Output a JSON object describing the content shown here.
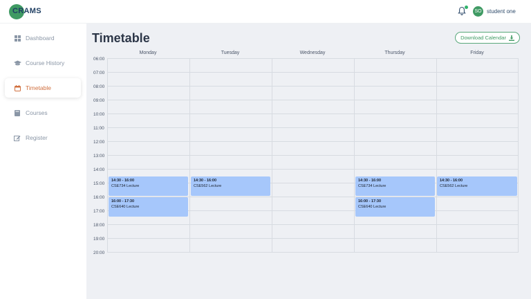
{
  "app": {
    "logo_text": "CRAMS"
  },
  "user": {
    "initials": "SO",
    "name": "student one"
  },
  "sidebar": {
    "items": [
      {
        "label": "Dashboard",
        "icon": "dashboard-icon"
      },
      {
        "label": "Course History",
        "icon": "graduation-cap-icon"
      },
      {
        "label": "Timetable",
        "icon": "calendar-icon",
        "active": true
      },
      {
        "label": "Courses",
        "icon": "book-icon"
      },
      {
        "label": "Register",
        "icon": "edit-icon"
      }
    ]
  },
  "page": {
    "title": "Timetable",
    "download_label": "Download Calendar"
  },
  "calendar": {
    "days": [
      "Monday",
      "Tuesday",
      "Wednesday",
      "Thursday",
      "Friday"
    ],
    "hours": [
      "06:00",
      "07:00",
      "08:00",
      "09:00",
      "10:00",
      "11:00",
      "12:00",
      "13:00",
      "14:00",
      "15:00",
      "16:00",
      "17:00",
      "18:00",
      "19:00",
      "20:00"
    ],
    "events": [
      {
        "day": "Monday",
        "time": "14:30 - 16:00",
        "title": "CSE734 Lecture",
        "start_hour": 14.5,
        "end_hour": 16.0
      },
      {
        "day": "Monday",
        "time": "16:00 - 17:30",
        "title": "CSE640 Lecture",
        "start_hour": 16.0,
        "end_hour": 17.5
      },
      {
        "day": "Tuesday",
        "time": "14:30 - 16:00",
        "title": "CSE562 Lecture",
        "start_hour": 14.5,
        "end_hour": 16.0
      },
      {
        "day": "Thursday",
        "time": "14:30 - 16:00",
        "title": "CSE734 Lecture",
        "start_hour": 14.5,
        "end_hour": 16.0
      },
      {
        "day": "Thursday",
        "time": "16:00 - 17:30",
        "title": "CSE640 Lecture",
        "start_hour": 16.0,
        "end_hour": 17.5
      },
      {
        "day": "Friday",
        "time": "14:30 - 16:00",
        "title": "CSE562 Lecture",
        "start_hour": 14.5,
        "end_hour": 16.0
      }
    ]
  },
  "colors": {
    "accent": "#3f9a63",
    "active_nav": "#d0703f",
    "event_bg": "#a6c7fb"
  }
}
